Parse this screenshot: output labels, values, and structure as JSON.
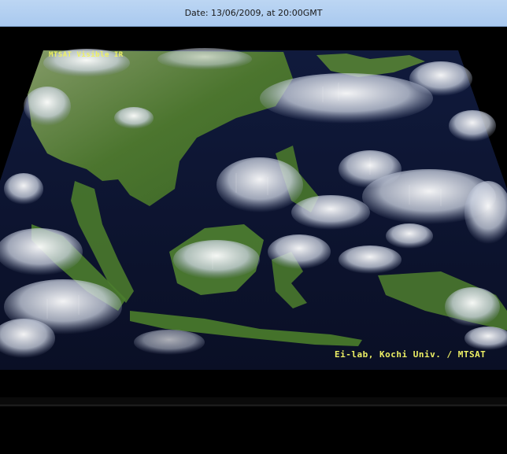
{
  "window": {
    "title": "Date: 13/06/2009, at 20:00GMT"
  },
  "scene": {
    "ocean_color": "#0b1231",
    "land_color": "#4f7a2e",
    "cloud_color": "#e9eef5"
  },
  "watermark": {
    "top_left": "MTSAT Visible IR",
    "bottom_right": "Ei-lab, Kochi Univ. / MTSAT"
  }
}
